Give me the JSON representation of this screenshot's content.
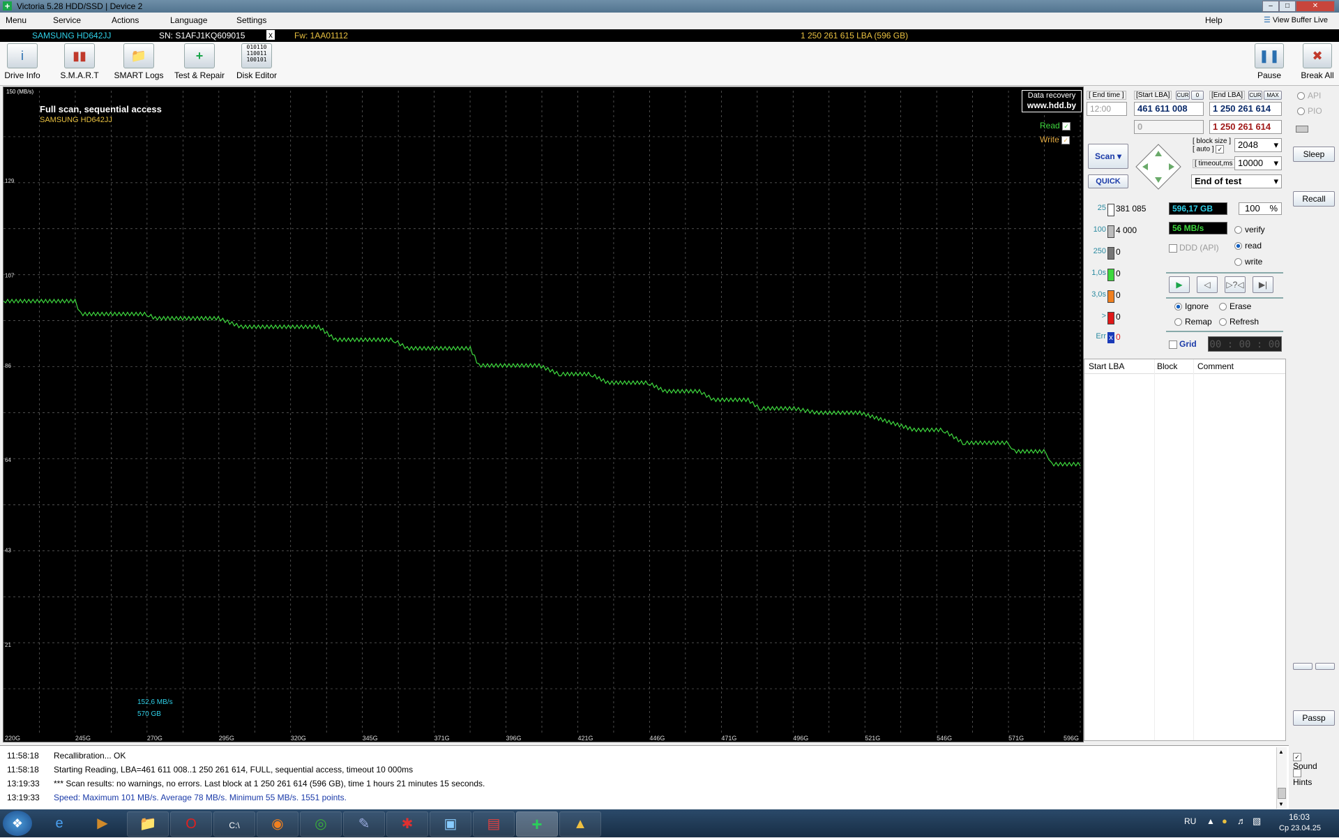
{
  "window": {
    "title": "Victoria 5.28 HDD/SSD | Device 2"
  },
  "menu": {
    "items": [
      "Menu",
      "Service",
      "Actions",
      "Language",
      "Settings"
    ],
    "help": "Help",
    "view_buffer": "View Buffer Live"
  },
  "infobar": {
    "model": "SAMSUNG HD642JJ",
    "serial": "SN: S1AFJ1KQ609015",
    "close": "x",
    "firmware": "Fw: 1AA01112",
    "capacity": "1 250 261 615 LBA (596 GB)"
  },
  "toolbar": {
    "buttons": [
      "Drive Info",
      "S.M.A.R.T",
      "SMART Logs",
      "Test & Repair",
      "Disk Editor"
    ],
    "pause": "Pause",
    "break_all": "Break All"
  },
  "graph": {
    "title": "Full scan, sequential access",
    "subtitle": "SAMSUNG HD642JJ",
    "watermark_line1": "Data recovery",
    "watermark_line2": "www.hdd.by",
    "legend_read": "Read",
    "legend_write": "Write",
    "cursor_speed": "152,6 MB/s",
    "cursor_pos": "570 GB"
  },
  "chart_data": {
    "type": "line",
    "title": "Full scan, sequential access",
    "subtitle": "SAMSUNG HD642JJ",
    "ylim": [
      0,
      150
    ],
    "y_top_label": "150 (MB/s)",
    "y_ticks": [
      "129",
      "107",
      "86",
      "64",
      "43",
      "21"
    ],
    "x_ticks": [
      "220G",
      "245G",
      "270G",
      "295G",
      "320G",
      "345G",
      "371G",
      "396G",
      "421G",
      "446G",
      "471G",
      "496G",
      "521G",
      "546G",
      "571G",
      "596G"
    ],
    "xlim": [
      220,
      596
    ],
    "grid": true,
    "series": [
      {
        "name": "Read",
        "x": [
          220,
          245,
          247,
          270,
          273,
          295,
          303,
          330,
          336,
          356,
          361,
          383,
          386,
          407,
          414,
          425,
          431,
          445,
          451,
          463,
          468,
          480,
          484,
          496,
          504,
          519,
          538,
          548,
          555,
          571,
          573,
          584,
          586,
          596
        ],
        "values": [
          101,
          101,
          98,
          98,
          97,
          97,
          95,
          95,
          92,
          92,
          90,
          90,
          86,
          86,
          84,
          84,
          82,
          82,
          80,
          80,
          78,
          78,
          76,
          76,
          75,
          75,
          71,
          71,
          68,
          68,
          66,
          66,
          63,
          63
        ]
      }
    ]
  },
  "controls": {
    "end_time_label": "[ End time ]",
    "end_time_value": "12:00",
    "start_lba_label": "[Start LBA]",
    "cur_label": "CUR",
    "zero_label": "0",
    "end_lba_label": "[End LBA]",
    "max_label": "MAX",
    "start_lba": "461 611 008",
    "end_lba": "1 250 261 614",
    "start_lba2": "0",
    "end_lba2": "1 250 261 614",
    "block_size_label": "[ block size ]",
    "auto_label": "[ auto ]",
    "block_size": "2048",
    "timeout_label": "[ timeout,ms ]",
    "timeout": "10000",
    "scan_button": "Scan",
    "quick_button": "QUICK",
    "end_action": "End of test",
    "stats": [
      {
        "label": "25",
        "value": "381 085"
      },
      {
        "label": "100",
        "value": "4 000"
      },
      {
        "label": "250",
        "value": "0"
      },
      {
        "label": "1,0s",
        "value": "0"
      },
      {
        "label": "3,0s",
        "value": "0"
      },
      {
        "label": ">",
        "value": "0"
      },
      {
        "label": "Err",
        "value": "0"
      }
    ],
    "position": "596,17 GB",
    "percent": "100",
    "percent_sign": "%",
    "speed": "56 MB/s",
    "ddd": "DDD (API)",
    "mode_verify": "verify",
    "mode_read": "read",
    "mode_write": "write",
    "ignore": "Ignore",
    "erase": "Erase",
    "remap": "Remap",
    "refresh": "Refresh",
    "grid": "Grid",
    "timer": "00 : 00 : 00",
    "table_headers": [
      "Start LBA",
      "Block",
      "Comment"
    ]
  },
  "side": {
    "api": "API",
    "pio": "PIO",
    "sleep": "Sleep",
    "recall": "Recall",
    "passp": "Passp",
    "sound": "Sound",
    "hints": "Hints"
  },
  "log": [
    {
      "time": "11:58:18",
      "text": "Recallibration... OK",
      "color": "#000000"
    },
    {
      "time": "11:58:18",
      "text": "Starting Reading, LBA=461 611 008..1 250 261 614, FULL, sequential access, timeout 10 000ms",
      "color": "#000000"
    },
    {
      "time": "13:19:33",
      "text": "*** Scan results: no warnings, no errors. Last block at 1 250 261 614 (596 GB), time 1 hours 21 minutes 15 seconds.",
      "color": "#000000"
    },
    {
      "time": "13:19:33",
      "text": "Speed: Maximum 101 MB/s. Average 78 MB/s. Minimum 55 MB/s. 1551 points.",
      "color": "#1a3aa8"
    }
  ],
  "taskbar": {
    "lang": "RU",
    "time": "16:03",
    "date": "Ср 23.04.25"
  },
  "colors": {
    "graph_line": "#3ed83e",
    "graph_bg": "#000000",
    "grid": "#6a6a6a",
    "accent_cyan": "#2fd0e8"
  }
}
